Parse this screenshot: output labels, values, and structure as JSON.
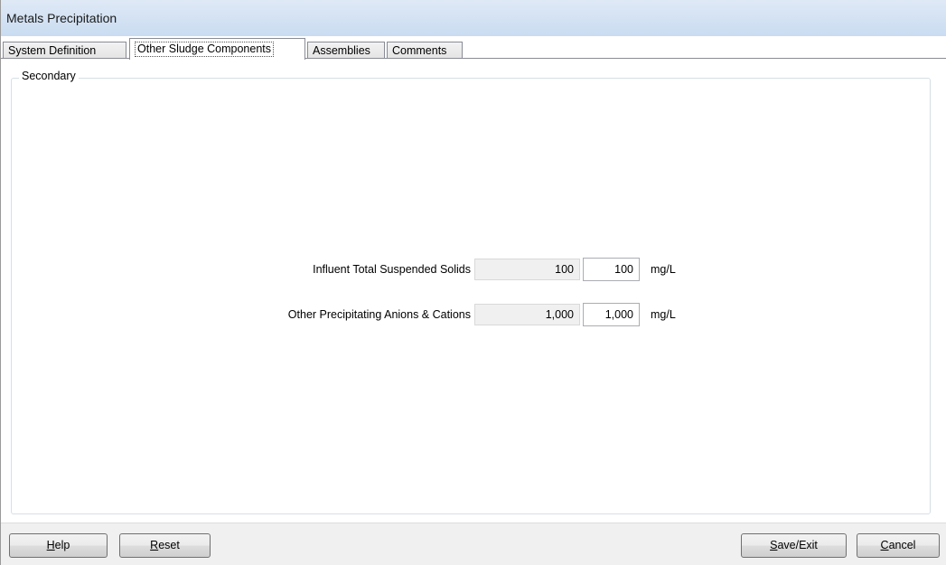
{
  "window": {
    "title": "Metals Precipitation"
  },
  "tabs": [
    {
      "label": "System Definition"
    },
    {
      "label": "Other Sludge Components"
    },
    {
      "label": "Assemblies"
    },
    {
      "label": "Comments"
    }
  ],
  "group": {
    "label": "Secondary"
  },
  "fields": [
    {
      "label": "Influent Total Suspended Solids",
      "default": "100",
      "value": "100",
      "unit": "mg/L"
    },
    {
      "label": "Other Precipitating Anions & Cations",
      "default": "1,000",
      "value": "1,000",
      "unit": "mg/L"
    }
  ],
  "buttons": {
    "help": {
      "mnemonic": "H",
      "rest": "elp"
    },
    "reset": {
      "mnemonic": "R",
      "rest": "eset"
    },
    "save": {
      "mnemonic": "S",
      "rest": "ave/Exit"
    },
    "cancel": {
      "mnemonic": "C",
      "rest": "ancel"
    }
  }
}
